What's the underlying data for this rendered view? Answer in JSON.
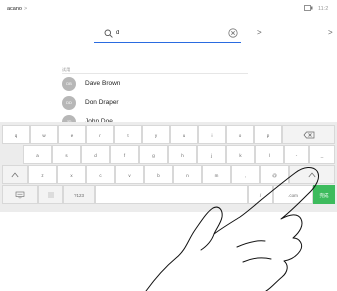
{
  "status": {
    "brand": "acano",
    "brand_chevron": ">",
    "time": "11:2"
  },
  "search": {
    "value": "d",
    "forward_glyph": ">",
    "forward_glyph_2": ">"
  },
  "list": {
    "section_label": "试用",
    "contacts": [
      {
        "initials": "DB",
        "name": "Dave Brown"
      },
      {
        "initials": "DD",
        "name": "Don Draper"
      },
      {
        "initials": "JD",
        "name": "John Doe"
      }
    ]
  },
  "keyboard": {
    "row1": [
      "q",
      "w",
      "e",
      "r",
      "t",
      "y",
      "u",
      "i",
      "o",
      "p"
    ],
    "row2": [
      "a",
      "s",
      "d",
      "f",
      "g",
      "h",
      "j",
      "k",
      "l",
      "-",
      "_"
    ],
    "row3": [
      "z",
      "x",
      "c",
      "v",
      "b",
      "n",
      "m",
      ",",
      "@"
    ],
    "row4": {
      "numbers_label": "?123",
      "slash": "/",
      "dotcom": ".com",
      "enter": "完成"
    },
    "icons": [
      "backspace-icon",
      "shift-icon",
      "keyboard-hide-icon",
      "emoji-icon"
    ]
  }
}
